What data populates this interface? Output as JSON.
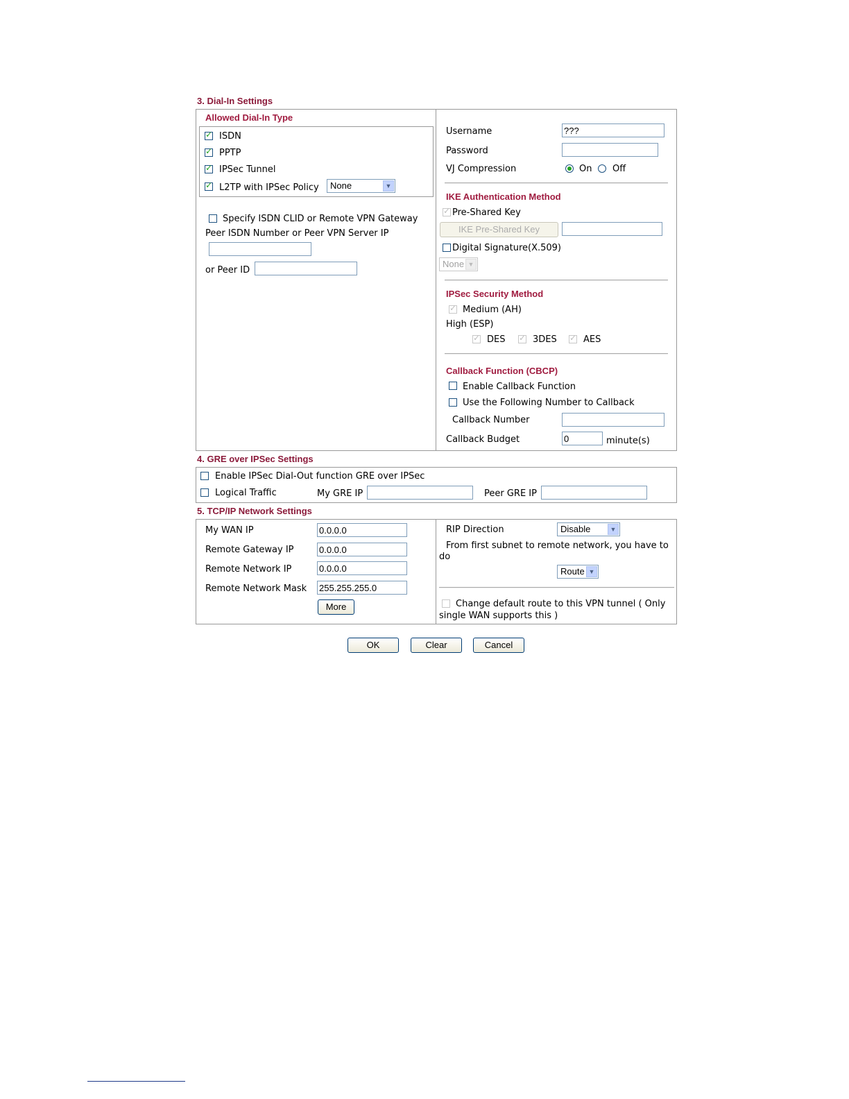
{
  "dialin": {
    "section_title": "3. Dial-In Settings",
    "allowed_title": "Allowed Dial-In Type",
    "types": [
      {
        "label": "ISDN",
        "checked": true
      },
      {
        "label": "PPTP",
        "checked": true
      },
      {
        "label": "IPSec Tunnel",
        "checked": true
      },
      {
        "label": "L2TP with IPSec Policy",
        "checked": true
      }
    ],
    "l2tp_policy": "None",
    "specify_label": "Specify ISDN CLID or Remote VPN Gateway",
    "peer_isdn_label": "Peer ISDN Number or Peer VPN Server IP",
    "peer_isdn_value": "",
    "peer_id_label": "or Peer ID",
    "peer_id_value": "",
    "username_label": "Username",
    "username_value": "???",
    "password_label": "Password",
    "password_value": "",
    "vj_label": "VJ Compression",
    "vj_on": "On",
    "vj_off": "Off",
    "ike_title": "IKE Authentication Method",
    "psk_label": "Pre-Shared Key",
    "ike_psk_button": "IKE Pre-Shared Key",
    "ike_psk_value": "",
    "digsig_label": "Digital Signature(X.509)",
    "digsig_select": "None",
    "ipsec_title": "IPSec Security Method",
    "medium_label": "Medium (AH)",
    "high_label": "High (ESP)",
    "des": "DES",
    "tdes": "3DES",
    "aes": "AES",
    "callback_title": "Callback Function (CBCP)",
    "enable_callback": "Enable Callback Function",
    "use_number": "Use the Following Number to Callback",
    "callback_number_label": "Callback Number",
    "callback_number_value": "",
    "callback_budget_label": "Callback Budget",
    "callback_budget_value": "0",
    "callback_budget_unit": "minute(s)"
  },
  "gre": {
    "section_title": "4. GRE over IPSec Settings",
    "enable_label": "Enable IPSec Dial-Out function GRE over IPSec",
    "logical_label": "Logical Traffic",
    "my_gre_label": "My GRE IP",
    "my_gre_value": "",
    "peer_gre_label": "Peer GRE IP",
    "peer_gre_value": ""
  },
  "tcpip": {
    "section_title": "5. TCP/IP Network Settings",
    "my_wan_label": "My WAN IP",
    "my_wan_value": "0.0.0.0",
    "remote_gw_label": "Remote Gateway IP",
    "remote_gw_value": "0.0.0.0",
    "remote_net_label": "Remote Network IP",
    "remote_net_value": "0.0.0.0",
    "remote_mask_label": "Remote Network Mask",
    "remote_mask_value": "255.255.255.0",
    "more_button": "More",
    "rip_label": "RIP Direction",
    "rip_value": "Disable",
    "from_subnet_text": "From first subnet to remote network, you have to",
    "from_subnet_text2": "do",
    "route_value": "Route",
    "change_default_text": "Change default route to this VPN tunnel ( Only",
    "change_default_text2": "single WAN supports this )"
  },
  "buttons": {
    "ok": "OK",
    "clear": "Clear",
    "cancel": "Cancel"
  }
}
